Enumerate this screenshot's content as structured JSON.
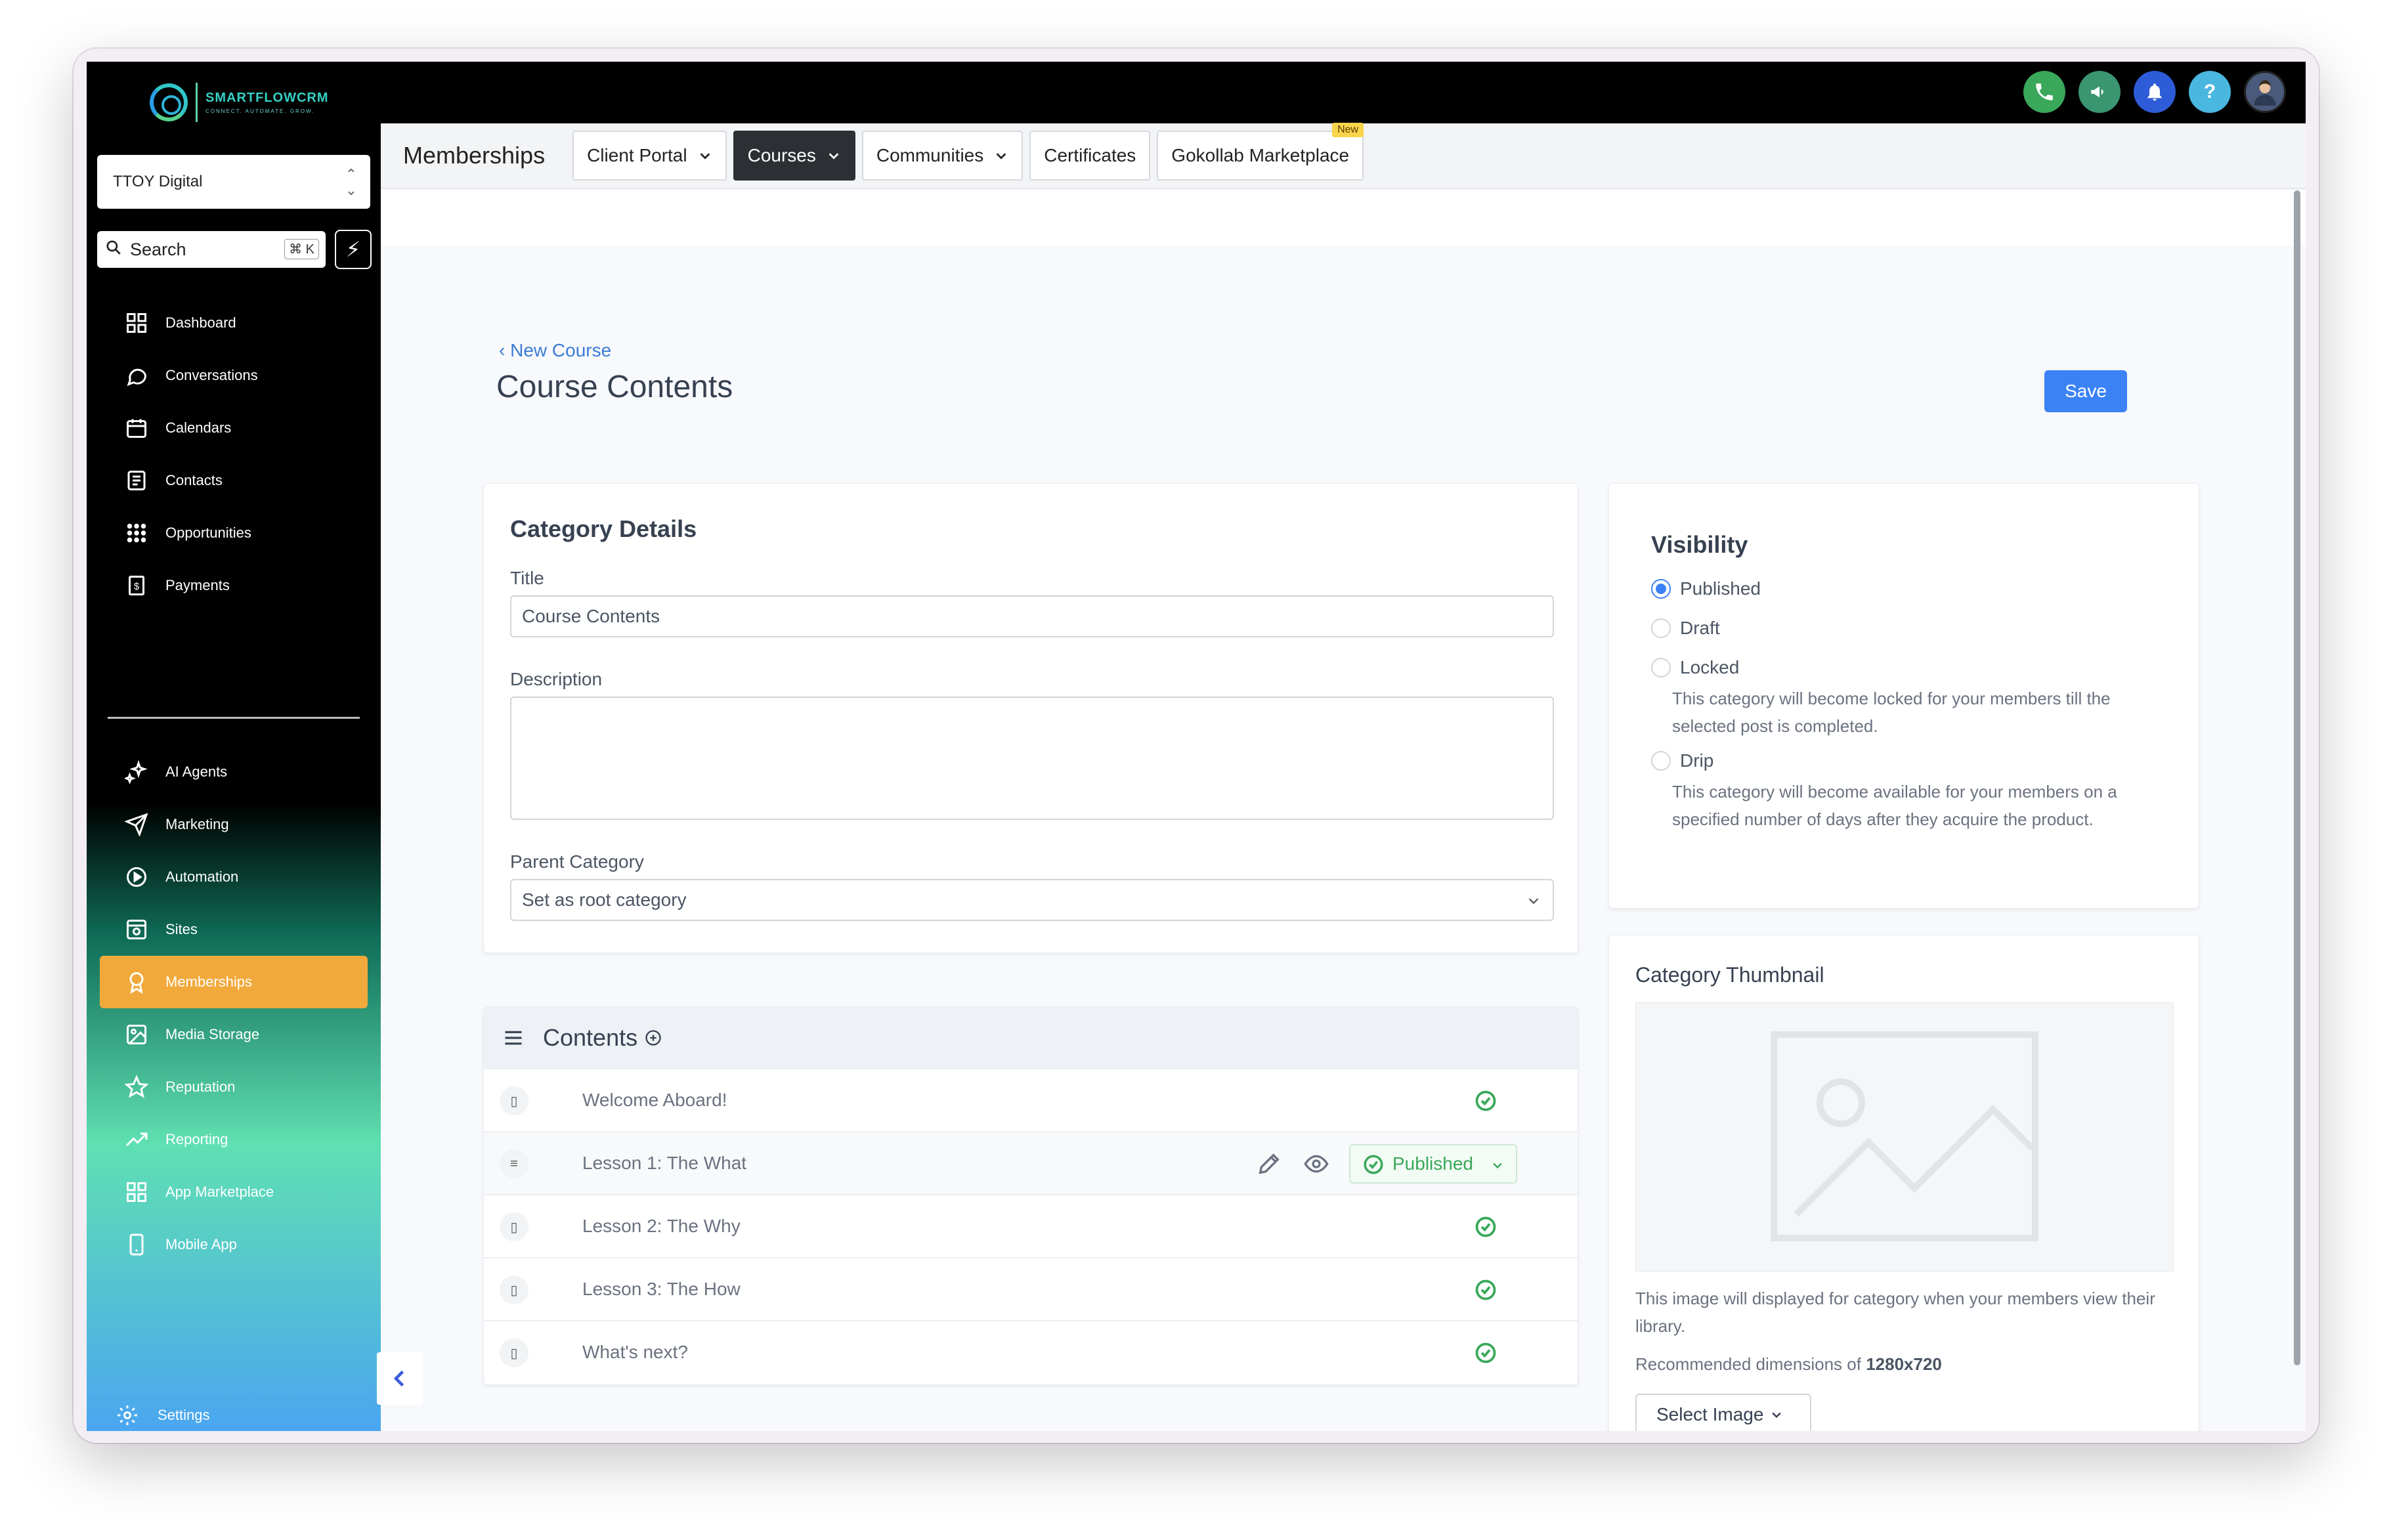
{
  "brand": {
    "name": "SMARTFLOWCRM",
    "tagline": "CONNECT. AUTOMATE. GROW."
  },
  "topbar": {
    "icons": [
      {
        "name": "phone-icon",
        "color": "#3aa85a"
      },
      {
        "name": "megaphone-icon",
        "color": "#3a9670"
      },
      {
        "name": "bell-icon",
        "color": "#2e5bd8"
      },
      {
        "name": "help-icon",
        "color": "#4ab7e0",
        "glyph": "?"
      },
      {
        "name": "avatar",
        "color": "#4a5a7a"
      }
    ]
  },
  "sidebar": {
    "account": "TTOY Digital",
    "search_placeholder": "Search",
    "search_shortcut": "⌘ K",
    "items": [
      {
        "label": "Dashboard",
        "icon": "dashboard-icon"
      },
      {
        "label": "Conversations",
        "icon": "chat-icon"
      },
      {
        "label": "Calendars",
        "icon": "calendar-icon"
      },
      {
        "label": "Contacts",
        "icon": "contacts-icon"
      },
      {
        "label": "Opportunities",
        "icon": "opportunities-icon"
      },
      {
        "label": "Payments",
        "icon": "payments-icon"
      },
      {
        "label": "AI Agents",
        "icon": "sparkles-icon"
      },
      {
        "label": "Marketing",
        "icon": "send-icon"
      },
      {
        "label": "Automation",
        "icon": "automation-icon"
      },
      {
        "label": "Sites",
        "icon": "sites-icon"
      },
      {
        "label": "Memberships",
        "icon": "award-icon",
        "active": true
      },
      {
        "label": "Media Storage",
        "icon": "image-icon"
      },
      {
        "label": "Reputation",
        "icon": "star-icon"
      },
      {
        "label": "Reporting",
        "icon": "trending-icon"
      },
      {
        "label": "App Marketplace",
        "icon": "grid-icon"
      },
      {
        "label": "Mobile App",
        "icon": "mobile-icon"
      }
    ],
    "settings": "Settings"
  },
  "tabs": {
    "section": "Memberships",
    "items": [
      {
        "label": "Client Portal",
        "dropdown": true
      },
      {
        "label": "Courses",
        "dropdown": true,
        "active": true
      },
      {
        "label": "Communities",
        "dropdown": true
      },
      {
        "label": "Certificates"
      },
      {
        "label": "Gokollab Marketplace",
        "badge": "New"
      }
    ]
  },
  "page": {
    "back_link": "New Course",
    "title": "Course Contents",
    "save": "Save"
  },
  "category_details": {
    "heading": "Category Details",
    "title_label": "Title",
    "title_value": "Course Contents",
    "description_label": "Description",
    "description_value": "",
    "parent_label": "Parent Category",
    "parent_value": "Set as root category"
  },
  "contents": {
    "heading": "Contents",
    "rows": [
      {
        "name": "Welcome Aboard!",
        "status": "published"
      },
      {
        "name": "Lesson 1: The What",
        "status": "Published",
        "hovered": true
      },
      {
        "name": "Lesson 2: The Why",
        "status": "published"
      },
      {
        "name": "Lesson 3: The How",
        "status": "published"
      },
      {
        "name": "What's next?",
        "status": "published"
      }
    ]
  },
  "visibility": {
    "heading": "Visibility",
    "options": [
      {
        "label": "Published",
        "selected": true
      },
      {
        "label": "Draft"
      },
      {
        "label": "Locked",
        "help": "This category will become locked for your members till the selected post is completed."
      },
      {
        "label": "Drip",
        "help": "This category will become available for your members on a specified number of days after they acquire the product."
      }
    ]
  },
  "thumbnail": {
    "heading": "Category Thumbnail",
    "help": "This image will displayed for category when your members view their library.",
    "dims_prefix": "Recommended dimensions of ",
    "dims_value": "1280x720",
    "select": "Select Image"
  },
  "colors": {
    "accent": "#3b82f6",
    "active_nav": "#f2a93b",
    "success": "#3aa85a"
  }
}
